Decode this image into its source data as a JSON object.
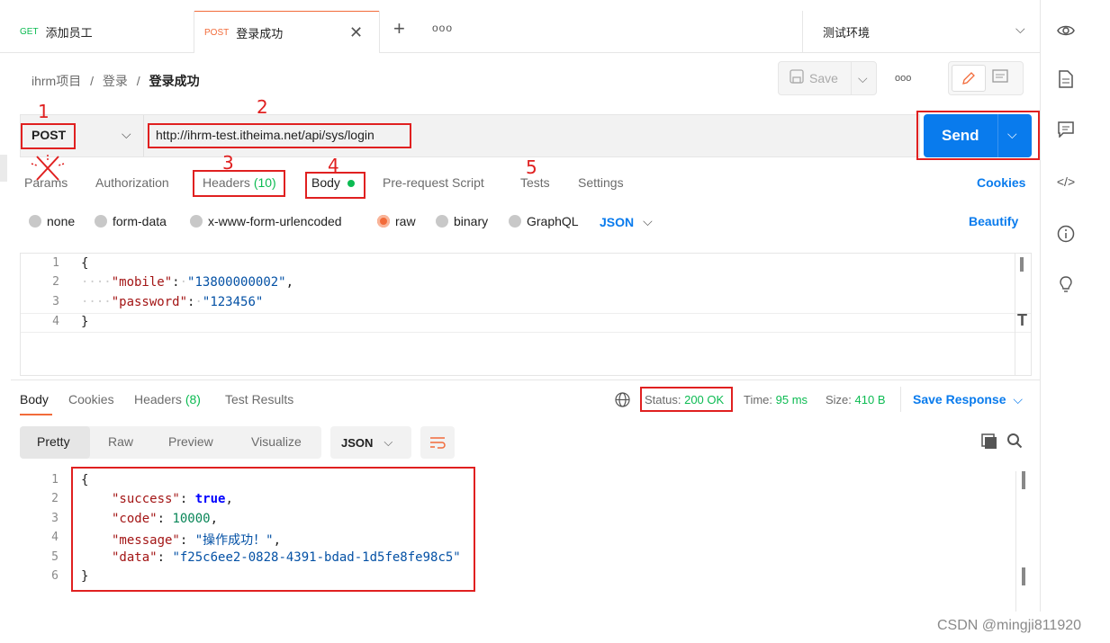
{
  "tabs": [
    {
      "method": "GET",
      "name": "添加员工"
    },
    {
      "method": "POST",
      "name": "登录成功"
    }
  ],
  "env_name": "测试环境",
  "breadcrumb": {
    "part1": "ihrm项目",
    "sep": "/",
    "part2": "登录",
    "current": "登录成功"
  },
  "save_label": "Save",
  "request": {
    "method": "POST",
    "url": "http://ihrm-test.itheima.net/api/sys/login",
    "send_label": "Send"
  },
  "request_tabs": {
    "params": "Params",
    "authorization": "Authorization",
    "headers": "Headers",
    "headers_count": "(10)",
    "body": "Body",
    "prerequest": "Pre-request Script",
    "tests": "Tests",
    "settings": "Settings",
    "cookies": "Cookies"
  },
  "body_types": {
    "none": "none",
    "form_data": "form-data",
    "urlencoded": "x-www-form-urlencoded",
    "raw": "raw",
    "binary": "binary",
    "graphql": "GraphQL",
    "format": "JSON",
    "beautify": "Beautify"
  },
  "request_body": {
    "line_numbers": [
      "1",
      "2",
      "3",
      "4"
    ],
    "open": "{",
    "k1": "\"mobile\"",
    "v1": "\"13800000002\"",
    "k2": "\"password\"",
    "v2": "\"123456\"",
    "close": "}"
  },
  "response_tabs": {
    "body": "Body",
    "cookies": "Cookies",
    "headers": "Headers",
    "headers_count": "(8)",
    "tests": "Test Results"
  },
  "response_meta": {
    "status_label": "Status:",
    "status_value": "200 OK",
    "time_label": "Time:",
    "time_value": "95 ms",
    "size_label": "Size:",
    "size_value": "410 B",
    "save_response": "Save Response"
  },
  "view_tabs": {
    "pretty": "Pretty",
    "raw": "Raw",
    "preview": "Preview",
    "visualize": "Visualize",
    "format": "JSON"
  },
  "response_body": {
    "line_numbers": [
      "1",
      "2",
      "3",
      "4",
      "5",
      "6"
    ],
    "open": "{",
    "k1": "\"success\"",
    "v1": "true",
    "k2": "\"code\"",
    "v2": "10000",
    "k3": "\"message\"",
    "v3": "\"操作成功！\"",
    "k4": "\"data\"",
    "v4": "\"f25c6ee2-0828-4391-bdad-1d5fe8fe98c5\"",
    "close": "}"
  },
  "annotations": [
    "1",
    "2",
    "3",
    "4",
    "5"
  ],
  "watermark": "CSDN @mingji811920",
  "colors": {
    "accent": "#097bed",
    "orange": "#f26b3a",
    "green": "#0cbb52",
    "annotation": "#e02020"
  }
}
